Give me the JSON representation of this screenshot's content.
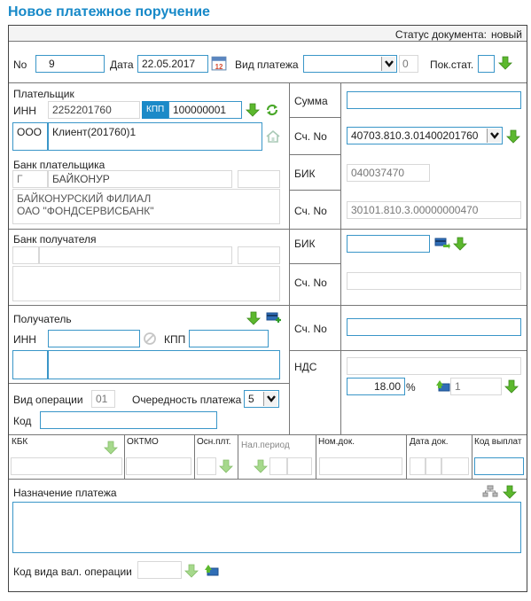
{
  "page": {
    "title": "Новое платежное поручение"
  },
  "status": {
    "label": "Статус документа:",
    "value": "новый"
  },
  "header": {
    "number_label": "No",
    "number_value": "9",
    "date_label": "Дата",
    "date_value": "22.05.2017",
    "payment_type_label": "Вид платежа",
    "payment_type_value": "",
    "payment_type_code": "0",
    "status_indicator_label": "Пок.стат.",
    "status_indicator_value": ""
  },
  "payer": {
    "section_label": "Плательщик",
    "inn_label": "ИНН",
    "inn_value": "2252201760",
    "kpp_label": "КПП",
    "kpp_value": "100000001",
    "org_form": "ООО",
    "name": "Клиент(201760)1"
  },
  "payer_bank": {
    "section_label": "Банк плательщика",
    "city_prefix": "Г",
    "city": "БАЙКОНУР",
    "name_line1": "БАЙКОНУРСКИЙ ФИЛИАЛ",
    "name_line2": "ОАО \"ФОНДСЕРВИСБАНК\""
  },
  "amounts": {
    "sum_label": "Сумма",
    "sum_value": "",
    "account_label": "Сч. No",
    "account_value": "40703.810.3.01400201760",
    "bik_label": "БИК",
    "bik_value": "040037470",
    "corr_account_label": "Сч. No",
    "corr_account_value": "30101.810.3.00000000470"
  },
  "payee_bank": {
    "section_label": "Банк получателя",
    "bik_label": "БИК",
    "bik_value": "",
    "corr_account_label": "Сч. No",
    "corr_account_value": ""
  },
  "payee": {
    "section_label": "Получатель",
    "inn_label": "ИНН",
    "inn_value": "",
    "kpp_label": "КПП",
    "kpp_value": "",
    "account_label": "Сч. No",
    "account_value": ""
  },
  "vat": {
    "label": "НДС",
    "rate_value": "18.00",
    "rate_unit": "%",
    "mode_value": "1"
  },
  "operation": {
    "op_type_label": "Вид операции",
    "op_type_value": "01",
    "priority_label": "Очередность платежа",
    "priority_value": "5",
    "code_label": "Код",
    "code_value": ""
  },
  "budget": {
    "kbk_label": "КБК",
    "oktmo_label": "ОКТМО",
    "basis_label": "Осн.плт.",
    "period_label": "Нал.период",
    "doc_num_label": "Ном.док.",
    "doc_date_label": "Дата док.",
    "payment_code_label": "Код выплат"
  },
  "purpose": {
    "label": "Назначение платежа",
    "value": "",
    "currency_op_label": "Код вида вал. операции",
    "currency_op_value": ""
  },
  "colors": {
    "accent": "#1789c8",
    "input_border": "#3a96c8",
    "arrow_green": "#5cb82e",
    "kpp_badge": "#1b8ac8"
  }
}
